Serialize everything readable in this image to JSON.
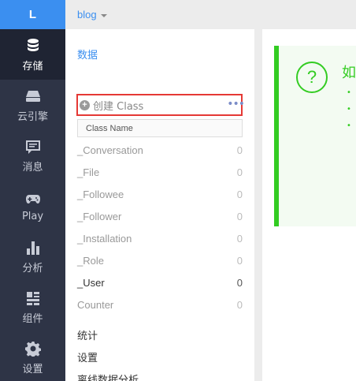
{
  "nav": {
    "logo": "L",
    "items": [
      {
        "label": "存储",
        "icon": "database-icon"
      },
      {
        "label": "云引擎",
        "icon": "server-icon"
      },
      {
        "label": "消息",
        "icon": "message-icon"
      },
      {
        "label": "Play",
        "icon": "gamepad-icon"
      },
      {
        "label": "分析",
        "icon": "bar-chart-icon"
      },
      {
        "label": "组件",
        "icon": "components-icon"
      },
      {
        "label": "设置",
        "icon": "gear-icon"
      }
    ]
  },
  "topbar": {
    "app_name": "blog"
  },
  "sidebar": {
    "section_title": "数据",
    "create_label": "创建 Class",
    "more_label": "•••",
    "class_placeholder": "Class Name",
    "classes": [
      {
        "name": "_Conversation",
        "count": "0"
      },
      {
        "name": "_File",
        "count": "0"
      },
      {
        "name": "_Followee",
        "count": "0"
      },
      {
        "name": "_Follower",
        "count": "0"
      },
      {
        "name": "_Installation",
        "count": "0"
      },
      {
        "name": "_Role",
        "count": "0"
      },
      {
        "name": "_User",
        "count": "0"
      },
      {
        "name": "Counter",
        "count": "0"
      }
    ],
    "menu": [
      "统计",
      "设置",
      "离线数据分析"
    ]
  },
  "notice": {
    "icon_text": "?",
    "title": "如",
    "bullets": [
      "•",
      "•",
      "•"
    ]
  },
  "colors": {
    "accent": "#3b8ff0",
    "nav_bg": "#2e3446",
    "highlight_border": "#e53935",
    "notice_green": "#33cc22"
  }
}
